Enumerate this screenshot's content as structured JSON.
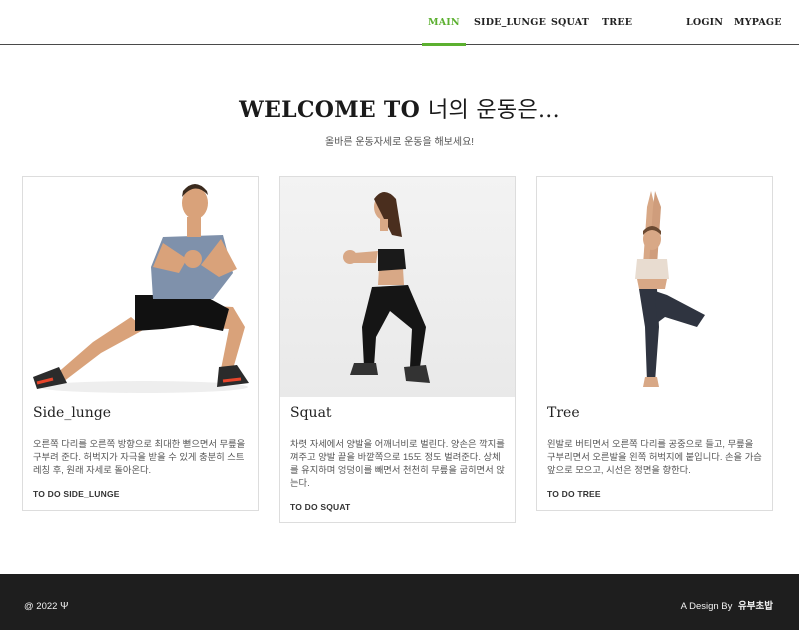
{
  "nav": {
    "left": [
      "MAIN",
      "SIDE_LUNGE",
      "SQUAT",
      "TREE"
    ],
    "right": [
      "LOGIN",
      "MYPAGE"
    ],
    "active": "MAIN",
    "accent_color": "#5cb030"
  },
  "hero": {
    "title_en": "WELCOME TO ",
    "title_kr": "너의 운동은...",
    "subtitle": "올바른 운동자세로 운동을 해보세요!"
  },
  "cards": [
    {
      "title": "Side_lunge",
      "description": "오른쪽 다리를 오른쪽 방향으로 최대한 뻗으면서 무릎을 구부려 준다. 허벅지가 자극을 받을 수 있게 충분히 스트레칭 후, 원래 자세로 돌아온다.",
      "cta": "TO DO SIDE_LUNGE",
      "image": "man-side-lunge-photo"
    },
    {
      "title": "Squat",
      "description": "차렷 자세에서 양발을 어깨너비로 벌린다. 양손은 깍지를 껴주고 양발 끝을 바깥쪽으로 15도 정도 벌려준다. 상체를 유지하며 엉덩이를 빼면서 천천히 무릎을 굽히면서 앉는다.",
      "cta": "TO DO SQUAT",
      "image": "woman-squat-photo"
    },
    {
      "title": "Tree",
      "description": "왼발로 버티면서 오른쪽 다리를 공중으로 들고, 무릎을 구부리면서 오른발을 왼쪽 허벅지에 붙입니다. 손을 가슴 앞으로 모으고, 시선은 정면을 향한다.",
      "cta": "TO DO TREE",
      "image": "woman-tree-pose-photo"
    }
  ],
  "footer": {
    "copyright": "@ 2022 ",
    "design_prefix": "A Design By ",
    "designer": "유부초밥"
  }
}
